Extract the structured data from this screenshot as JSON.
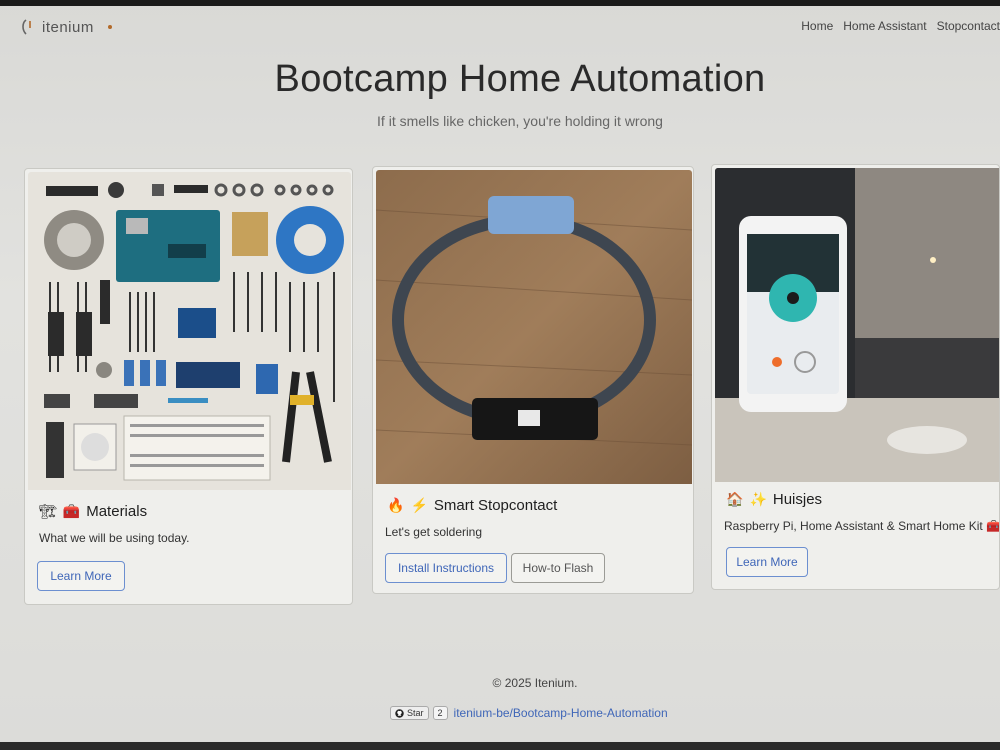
{
  "brand": {
    "name": "itenium",
    "icon": "itenium-logo-icon",
    "accent": "#b26a2a"
  },
  "nav": {
    "links": [
      "Home",
      "Home Assistant",
      "Stopcontact"
    ]
  },
  "hero": {
    "title": "Bootcamp Home Automation",
    "subtitle": "If it smells like chicken, you're holding it wrong"
  },
  "cards": [
    {
      "emoji": [
        "🏗",
        "🧰"
      ],
      "title": "Materials",
      "text": "What we will be using today.",
      "buttons": [
        "Learn More"
      ],
      "image": "electronics-components-flatlay"
    },
    {
      "emoji": [
        "🔥",
        "⚡"
      ],
      "title": "Smart Stopcontact",
      "text": "Let's get soldering",
      "buttons": [
        "Install Instructions",
        "How-to Flash"
      ],
      "image": "smart-plug-cable-on-wood"
    },
    {
      "emoji": [
        "🏠",
        "✨"
      ],
      "title": "Huisjes",
      "text": "Raspberry Pi, Home Assistant & Smart Home Kit 🧰",
      "buttons": [
        "Learn More"
      ],
      "image": "smartphone-home-dashboard"
    }
  ],
  "footer": {
    "copyright": "© 2025 Itenium.",
    "github": {
      "star_label": "Star",
      "star_count": "2",
      "repo": "itenium-be/Bootcamp-Home-Automation"
    }
  },
  "colors": {
    "primary": "#3f66b8",
    "secondary": "#555555"
  }
}
